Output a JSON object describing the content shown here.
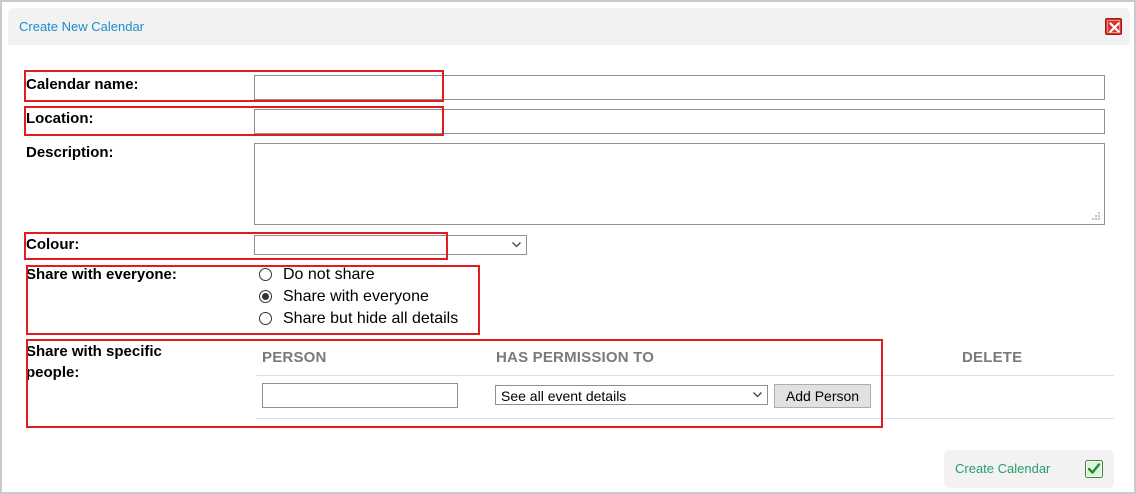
{
  "dialog": {
    "title": "Create New Calendar"
  },
  "form": {
    "calendar_name": {
      "label": "Calendar name:",
      "value": ""
    },
    "location": {
      "label": "Location:",
      "value": ""
    },
    "description": {
      "label": "Description:",
      "value": ""
    },
    "colour": {
      "label": "Colour:",
      "selected": ""
    },
    "share_everyone": {
      "label": "Share with everyone:",
      "options": [
        "Do not share",
        "Share with everyone",
        "Share but hide all details"
      ],
      "selected": "Share with everyone"
    },
    "share_specific": {
      "label": "Share with specific people:",
      "columns": [
        "PERSON",
        "HAS PERMISSION TO",
        "DELETE"
      ],
      "person_value": "",
      "permission_selected": "See all event details",
      "add_person_label": "Add Person"
    }
  },
  "footer": {
    "create_label": "Create Calendar"
  },
  "colors": {
    "accent_blue": "#1a8fc7",
    "accent_green": "#2a9d6b",
    "highlight_red": "#e11b22"
  },
  "icons": {
    "close": "close-icon",
    "create": "checkmark-icon",
    "dropdown": "chevron-down-icon"
  }
}
